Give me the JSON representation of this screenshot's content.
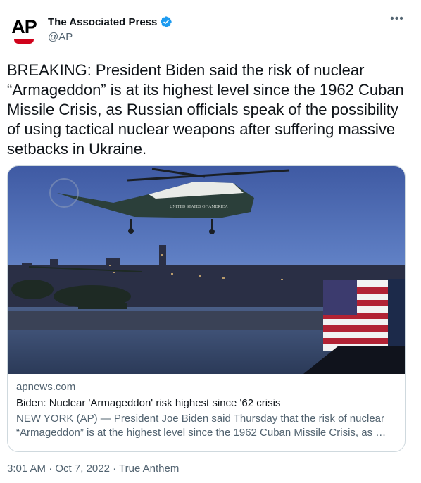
{
  "author": {
    "logo_text": "AP",
    "display_name": "The Associated Press",
    "handle": "@AP",
    "verified_icon": "verified-badge-icon"
  },
  "menu": {
    "more_label": "•••"
  },
  "tweet": {
    "text": "BREAKING: President Biden said the risk of nuclear “Armageddon” is at its highest level since the 1962 Cuban Missile Crisis, as Russian officials speak of the possibility of using tactical nuclear weapons after suffering massive setbacks in Ukraine."
  },
  "card": {
    "domain": "apnews.com",
    "title": "Biden: Nuclear 'Armageddon' risk highest since '62 crisis",
    "description": "NEW YORK (AP) — President Joe Biden said Thursday that the risk of nuclear “Armageddon” is at the highest level since the 1962 Cuban Missile Crisis, as …",
    "image_text": "UNITED STATES OF AMERICA"
  },
  "meta": {
    "time": "3:01 AM",
    "sep1": "·",
    "date": "Oct 7, 2022",
    "sep2": "·",
    "source": "True Anthem"
  },
  "colors": {
    "text": "#0f1419",
    "secondary": "#536471",
    "verified": "#1d9bf0",
    "border": "#cfd9de",
    "ap_red": "#d0021b"
  }
}
